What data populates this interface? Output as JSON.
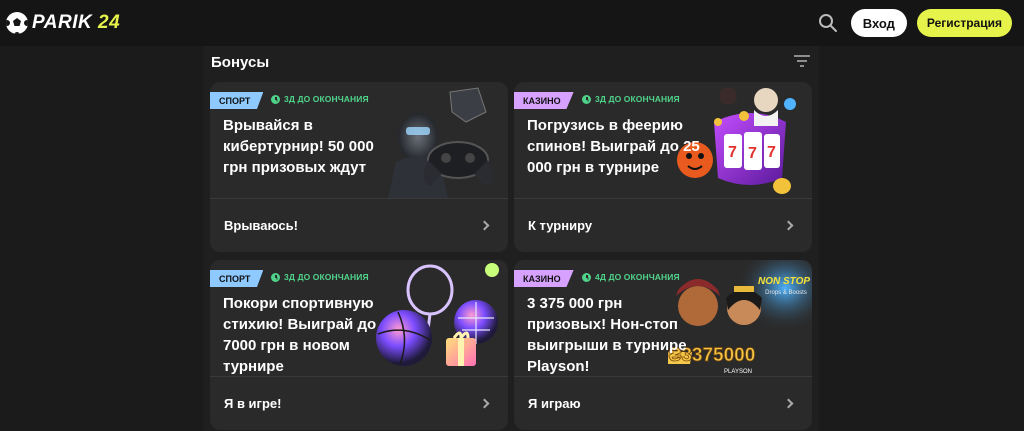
{
  "header": {
    "logo_text": "PARIK",
    "logo_number": "24",
    "login_label": "Вход",
    "register_label": "Регистрация",
    "accent": "#e6f34a"
  },
  "page": {
    "title": "Бонусы"
  },
  "cards": [
    {
      "tag": "СПОРТ",
      "timer": "3Д ДО ОКОНЧАНИЯ",
      "heading": "Врывайся в кибертурнир! 50 000 грн призовых ждут",
      "action": "Врываюсь!",
      "icon": "cyber-robot-gamepad-icon"
    },
    {
      "tag": "КАЗИНО",
      "timer": "3Д ДО ОКОНЧАНИЯ",
      "heading": "Погрузись в феерию спинов! Выиграй до 25 000 грн в турнире",
      "action": "К турниру",
      "icon": "slot-machine-icon"
    },
    {
      "tag": "СПОРТ",
      "timer": "3Д ДО ОКОНЧАНИЯ",
      "heading": "Покори спортивную стихию! Выиграй до 7000 грн в новом турнире",
      "action": "Я в игре!",
      "icon": "sports-balls-gift-icon"
    },
    {
      "tag": "КАЗИНО",
      "timer": "4Д ДО ОКОНЧАНИЯ",
      "heading": "3 375 000 грн призовых! Нон-стоп выигрыши в турнире Playson!",
      "action": "Я играю",
      "icon": "playson-promo-icon",
      "art_text": {
        "badge": "NON STOP",
        "sub": "Drops & Boosts",
        "amount": "₴3375000",
        "brand": "PLAYSON"
      }
    }
  ]
}
